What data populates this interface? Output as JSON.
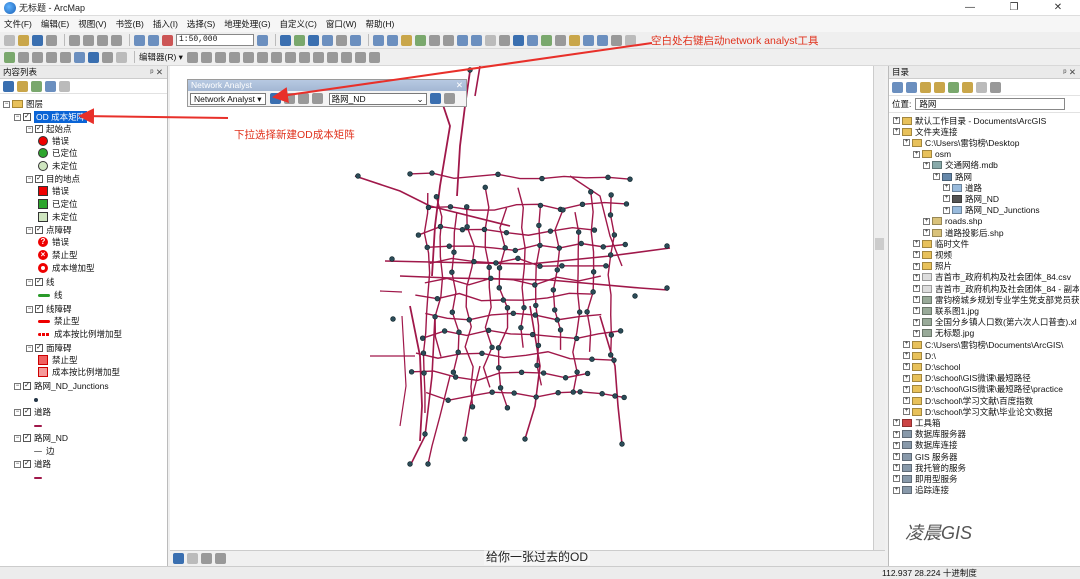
{
  "window": {
    "title": "无标题 - ArcMap",
    "controls": [
      "—",
      "❐",
      "✕"
    ]
  },
  "menu": [
    "文件(F)",
    "编辑(E)",
    "视图(V)",
    "书签(B)",
    "插入(I)",
    "选择(S)",
    "地理处理(G)",
    "自定义(C)",
    "窗口(W)",
    "帮助(H)"
  ],
  "toolbar": {
    "scale": "1:50,000",
    "editor_label": "编辑器(R) ▾"
  },
  "annotations": {
    "top_note": "空白处右键启动network analyst工具",
    "mid_note": "下拉选择新建OD成本矩阵",
    "caption": "给你一张过去的OD",
    "watermark": "凌晨GIS"
  },
  "toc": {
    "title": "内容列表",
    "pins": "ᵖ ✕",
    "items": [
      {
        "label": "图层",
        "type": "group"
      },
      {
        "label": "OD 成本矩阵",
        "type": "layer",
        "selected": true
      },
      {
        "label": "起始点",
        "type": "sublayer"
      },
      {
        "label": "错误",
        "symbol": "circle-red"
      },
      {
        "label": "已定位",
        "symbol": "circle-green"
      },
      {
        "label": "未定位",
        "symbol": "circle-pale"
      },
      {
        "label": "目的地点",
        "type": "sublayer"
      },
      {
        "label": "错误",
        "symbol": "square-red"
      },
      {
        "label": "已定位",
        "symbol": "square-green"
      },
      {
        "label": "未定位",
        "symbol": "square-pale"
      },
      {
        "label": "点障碍",
        "type": "sublayer"
      },
      {
        "label": "错误",
        "symbol": "barrier-q"
      },
      {
        "label": "禁止型",
        "symbol": "barrier-x"
      },
      {
        "label": "成本增加型",
        "symbol": "barrier-ring"
      },
      {
        "label": "线",
        "type": "sublayer"
      },
      {
        "label": "线",
        "symbol": "line-green"
      },
      {
        "label": "线障碍",
        "type": "sublayer"
      },
      {
        "label": "禁止型",
        "symbol": "line-red"
      },
      {
        "label": "成本按比例增加型",
        "symbol": "line-red-dash"
      },
      {
        "label": "面障碍",
        "type": "sublayer"
      },
      {
        "label": "禁止型",
        "symbol": "poly-red"
      },
      {
        "label": "成本按比例增加型",
        "symbol": "poly-red2"
      },
      {
        "label": "路网_ND_Junctions",
        "type": "layer"
      },
      {
        "label": "",
        "symbol": "dot"
      },
      {
        "label": "道路",
        "type": "layer"
      },
      {
        "label": "",
        "symbol": "line-maroon"
      },
      {
        "label": "路网_ND",
        "type": "layer"
      },
      {
        "label": "边",
        "symbol": "edge"
      },
      {
        "label": "道路",
        "type": "layer"
      },
      {
        "label": "",
        "symbol": "line-maroon"
      }
    ]
  },
  "network_analyst": {
    "title": "Network Analyst",
    "dropdown": "Network Analyst ▾",
    "network": "路网_ND"
  },
  "catalog": {
    "title": "目录",
    "location_label": "位置:",
    "location_value": "路网",
    "items": [
      {
        "label": "默认工作目录 - Documents\\ArcGIS",
        "depth": 0,
        "icon": "home"
      },
      {
        "label": "文件夹连接",
        "depth": 0,
        "icon": "folder"
      },
      {
        "label": "C:\\Users\\雷钧榜\\Desktop",
        "depth": 1,
        "icon": "folder"
      },
      {
        "label": "osm",
        "depth": 2,
        "icon": "folder"
      },
      {
        "label": "交通网络.mdb",
        "depth": 3,
        "icon": "db"
      },
      {
        "label": "路网",
        "depth": 4,
        "icon": "dataset"
      },
      {
        "label": "道路",
        "depth": 5,
        "icon": "fc"
      },
      {
        "label": "路网_ND",
        "depth": 5,
        "icon": "nd"
      },
      {
        "label": "路网_ND_Junctions",
        "depth": 5,
        "icon": "fc"
      },
      {
        "label": "roads.shp",
        "depth": 3,
        "icon": "shp"
      },
      {
        "label": "道路投影后.shp",
        "depth": 3,
        "icon": "shp"
      },
      {
        "label": "临时文件",
        "depth": 2,
        "icon": "folder"
      },
      {
        "label": "视频",
        "depth": 2,
        "icon": "folder"
      },
      {
        "label": "照片",
        "depth": 2,
        "icon": "folder"
      },
      {
        "label": "吉首市_政府机构及社会团体_84.csv",
        "depth": 2,
        "icon": "file"
      },
      {
        "label": "吉首市_政府机构及社会团体_84 - 副本",
        "depth": 2,
        "icon": "file"
      },
      {
        "label": "雷钧榜城乡规划专业学生党支部党员获",
        "depth": 2,
        "icon": "table"
      },
      {
        "label": "联系图1.jpg",
        "depth": 2,
        "icon": "table"
      },
      {
        "label": "全国分乡镇人口数(第六次人口普查).xl",
        "depth": 2,
        "icon": "table"
      },
      {
        "label": "无标题.jpg",
        "depth": 2,
        "icon": "table"
      },
      {
        "label": "C:\\Users\\雷钧榜\\Documents\\ArcGIS\\",
        "depth": 1,
        "icon": "folder"
      },
      {
        "label": "D:\\",
        "depth": 1,
        "icon": "folder"
      },
      {
        "label": "D:\\school",
        "depth": 1,
        "icon": "folder"
      },
      {
        "label": "D:\\school\\GIS微课\\最短路径",
        "depth": 1,
        "icon": "folder"
      },
      {
        "label": "D:\\school\\GIS微课\\最短路径\\practice",
        "depth": 1,
        "icon": "folder"
      },
      {
        "label": "D:\\school\\学习文献\\百度指数",
        "depth": 1,
        "icon": "folder"
      },
      {
        "label": "D:\\school\\学习文献\\毕业论文\\数据",
        "depth": 1,
        "icon": "folder"
      },
      {
        "label": "工具箱",
        "depth": 0,
        "icon": "toolbox"
      },
      {
        "label": "数据库服务器",
        "depth": 0,
        "icon": "server"
      },
      {
        "label": "数据库连接",
        "depth": 0,
        "icon": "server"
      },
      {
        "label": "GIS 服务器",
        "depth": 0,
        "icon": "server"
      },
      {
        "label": "我托管的服务",
        "depth": 0,
        "icon": "server"
      },
      {
        "label": "即用型服务",
        "depth": 0,
        "icon": "server"
      },
      {
        "label": "追踪连接",
        "depth": 0,
        "icon": "server"
      }
    ]
  },
  "status": {
    "coords": "112.937  28.224  十进制度"
  },
  "colors": {
    "road": "#a0184a",
    "node": "#2b4b57",
    "arrow": "#e8302a",
    "selection": "#0a64d6"
  }
}
